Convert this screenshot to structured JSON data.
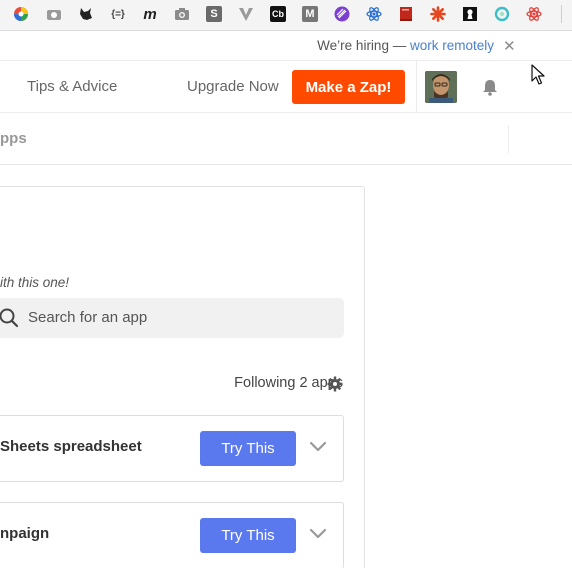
{
  "bookmarks": [
    {
      "name": "color-wheel-icon",
      "glyph": "",
      "color": "#d84fa0"
    },
    {
      "name": "camera-small-icon",
      "glyph": "",
      "color": "#9a9a9a"
    },
    {
      "name": "gnu-icon",
      "glyph": "",
      "color": "#222222"
    },
    {
      "name": "json-icon",
      "glyph": "{=}",
      "color": "#444444"
    },
    {
      "name": "m-italic-icon",
      "glyph": "m",
      "color": "#222222"
    },
    {
      "name": "camera-icon",
      "glyph": "",
      "color": "#8a8a8a"
    },
    {
      "name": "s-icon",
      "glyph": "S",
      "color": "#6a6a6a"
    },
    {
      "name": "v-icon",
      "glyph": "V",
      "color": "#8a8a8a"
    },
    {
      "name": "cb-icon",
      "glyph": "Cb",
      "color": "#111111"
    },
    {
      "name": "m-box-icon",
      "glyph": "M",
      "color": "#777777"
    },
    {
      "name": "stripe-circle-icon",
      "glyph": "",
      "color": "#7b3fd0"
    },
    {
      "name": "react-icon",
      "glyph": "",
      "color": "#2a6fd6"
    },
    {
      "name": "book-icon",
      "glyph": "",
      "color": "#c0281c"
    },
    {
      "name": "asterisk-icon",
      "glyph": "",
      "color": "#e8451e"
    },
    {
      "name": "keyhole-icon",
      "glyph": "",
      "color": "#111111"
    },
    {
      "name": "ring-icon",
      "glyph": "",
      "color": "#3cc0c8"
    },
    {
      "name": "atom-icon",
      "glyph": "",
      "color": "#e2403a"
    }
  ],
  "hiring": {
    "prefix": "We’re hiring —",
    "link": "work remotely",
    "close": "✕"
  },
  "nav": {
    "tips": "Tips & Advice",
    "upgrade": "Upgrade Now",
    "make_zap": "Make a Zap!"
  },
  "subnav": {
    "text": "pps"
  },
  "panel": {
    "helper": "ith this one!",
    "search_placeholder": "Search for an app",
    "following": "Following 2 apps"
  },
  "cards": [
    {
      "title": "Sheets spreadsheet",
      "button": "Try This"
    },
    {
      "title": "npaign",
      "button": "Try This"
    }
  ],
  "colors": {
    "zap_orange": "#ff4a00",
    "try_blue": "#5b79ee",
    "link_blue": "#4a7fd0"
  }
}
